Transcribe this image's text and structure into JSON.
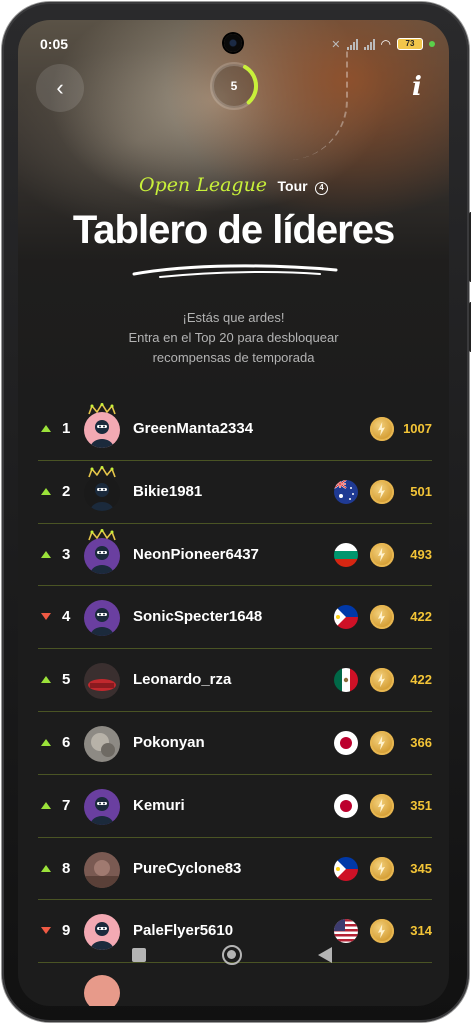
{
  "status_bar": {
    "time": "0:05",
    "battery": "73"
  },
  "header": {
    "progress_value": "5",
    "progress_fraction": 0.3,
    "league": "Open League",
    "tour_label": "Tour",
    "tour_number": "4",
    "title": "Tablero de líderes",
    "subtitle_line1": "¡Estás que ardes!",
    "subtitle_line2": "Entra en el Top 20 para desbloquear",
    "subtitle_line3": "recompensas de temporada"
  },
  "colors": {
    "accent": "#c8f03a",
    "points": "#f3c437",
    "up": "#9be23a",
    "down": "#f05a44",
    "divider": "#4a5424"
  },
  "leaderboard": [
    {
      "rank": "1",
      "trend": "up",
      "name": "GreenManta2334",
      "points": "1007",
      "flag": "",
      "crown": true,
      "avatar": "ninja-pink"
    },
    {
      "rank": "2",
      "trend": "up",
      "name": "Bikie1981",
      "points": "501",
      "flag": "australia",
      "crown": true,
      "avatar": "ninja-dark"
    },
    {
      "rank": "3",
      "trend": "up",
      "name": "NeonPioneer6437",
      "points": "493",
      "flag": "bulgaria",
      "crown": true,
      "avatar": "ninja-purple"
    },
    {
      "rank": "4",
      "trend": "down",
      "name": "SonicSpecter1648",
      "points": "422",
      "flag": "philippines",
      "crown": false,
      "avatar": "ninja-purple"
    },
    {
      "rank": "5",
      "trend": "up",
      "name": "Leonardo_rza",
      "points": "422",
      "flag": "mexico",
      "crown": false,
      "avatar": "photo-car"
    },
    {
      "rank": "6",
      "trend": "up",
      "name": "Pokonyan",
      "points": "366",
      "flag": "japan",
      "crown": false,
      "avatar": "photo-gray"
    },
    {
      "rank": "7",
      "trend": "up",
      "name": "Kemuri",
      "points": "351",
      "flag": "japan",
      "crown": false,
      "avatar": "ninja-purple"
    },
    {
      "rank": "8",
      "trend": "up",
      "name": "PureCyclone83",
      "points": "345",
      "flag": "philippines",
      "crown": false,
      "avatar": "photo-brown"
    },
    {
      "rank": "9",
      "trend": "down",
      "name": "PaleFlyer5610",
      "points": "314",
      "flag": "usa",
      "crown": false,
      "avatar": "ninja-pink"
    }
  ]
}
